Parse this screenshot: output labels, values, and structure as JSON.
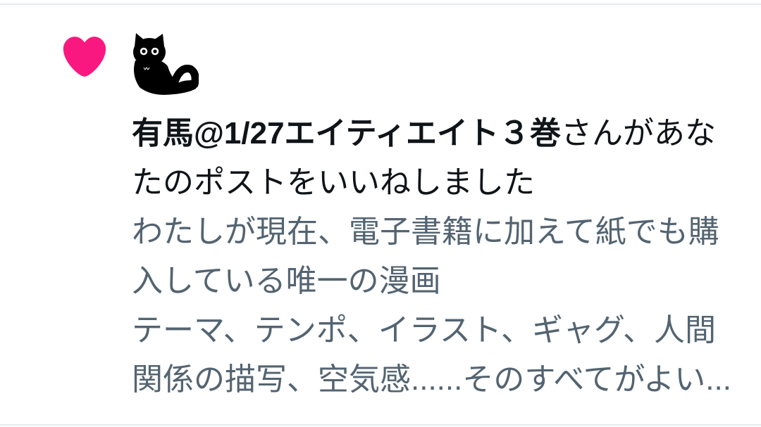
{
  "notification": {
    "type_icon": "heart-icon",
    "avatar_icon": "black-cat-avatar",
    "user_name": "有馬@1/27エイティエイト３巻",
    "action_text": "さんがあなたのポストをいいねしました",
    "post_lines": [
      "わたしが現在、電子書籍に加えて紙でも購入している唯一の漫画",
      "テーマ、テンポ、イラスト、ギャグ、人間関係の描写、空気感......そのすべてがよい..."
    ]
  },
  "colors": {
    "text_primary": "#0f1419",
    "text_secondary": "#536471",
    "heart": "#f91880",
    "divider": "#e6ebee"
  }
}
